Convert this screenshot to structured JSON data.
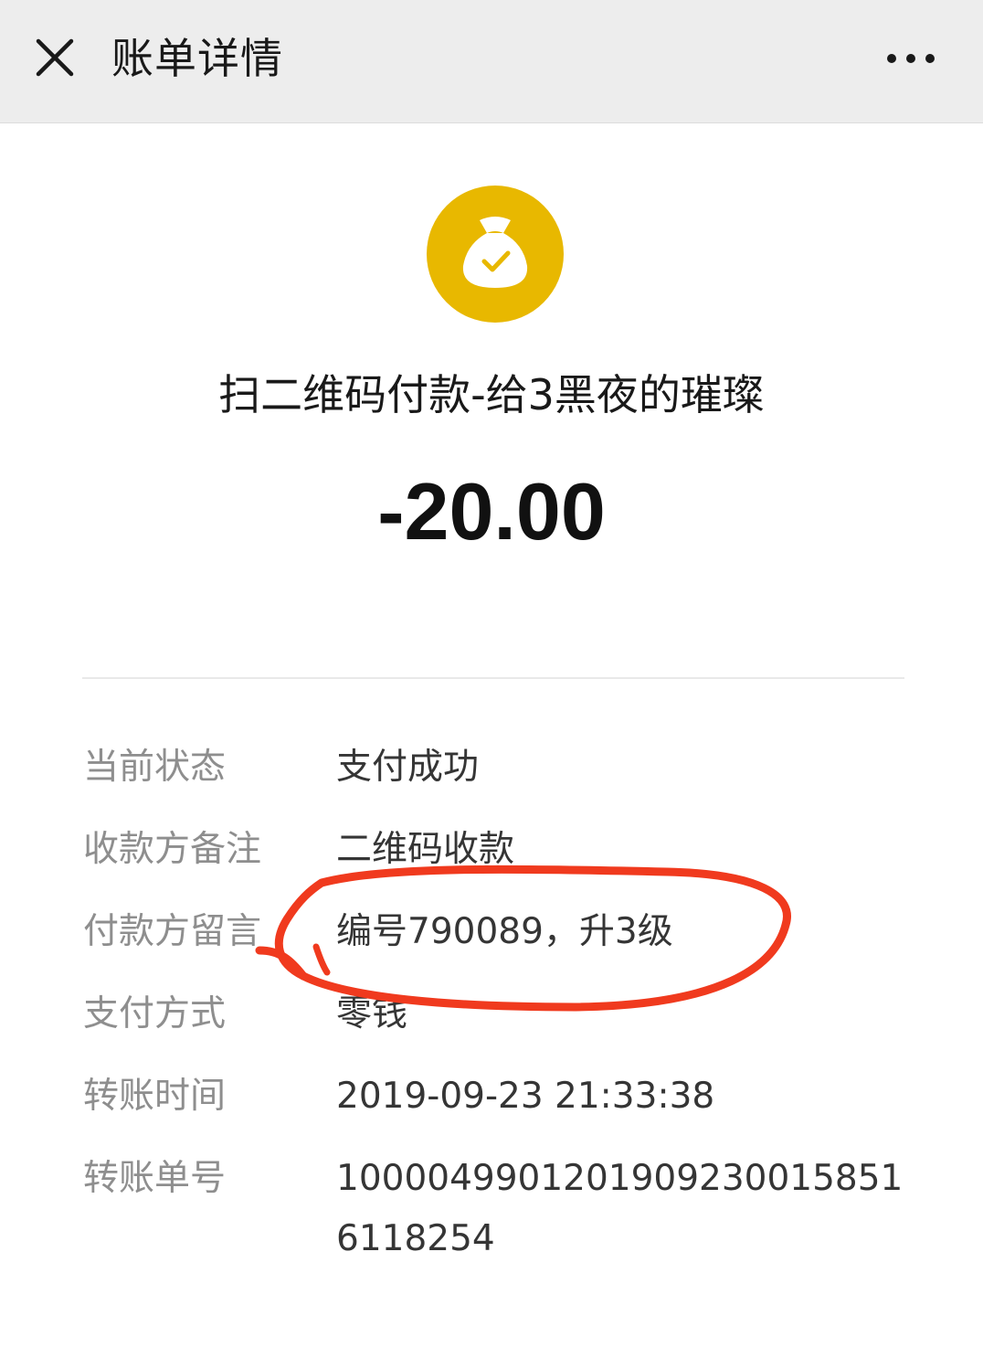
{
  "header": {
    "title": "账单详情",
    "close_icon": "close-icon",
    "more_icon": "more-dots-icon"
  },
  "summary": {
    "icon": "money-bag-check-icon",
    "icon_color": "#e8b800",
    "merchant": "扫二维码付款-给3黑夜的璀璨",
    "amount": "-20.00"
  },
  "details": [
    {
      "label": "当前状态",
      "value": "支付成功"
    },
    {
      "label": "收款方备注",
      "value": "二维码收款"
    },
    {
      "label": "付款方留言",
      "value": "编号790089，升3级"
    },
    {
      "label": "支付方式",
      "value": "零钱"
    },
    {
      "label": "转账时间",
      "value": "2019-09-23 21:33:38"
    },
    {
      "label": "转账单号",
      "value": "10000499012019092300158516118254"
    }
  ],
  "annotation": {
    "type": "hand-drawn red ellipse around 付款方留言 value",
    "color": "#f03a1e"
  }
}
